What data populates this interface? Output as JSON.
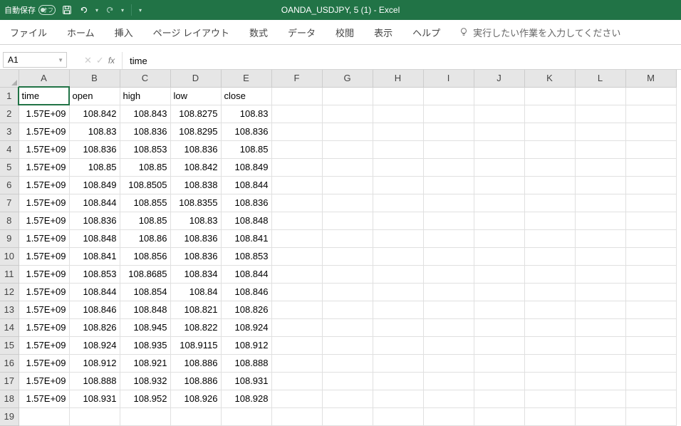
{
  "titlebar": {
    "autosave_label": "自動保存",
    "autosave_state": "オフ",
    "title": "OANDA_USDJPY, 5 (1)  -  Excel"
  },
  "ribbon": {
    "tabs": [
      "ファイル",
      "ホーム",
      "挿入",
      "ページ レイアウト",
      "数式",
      "データ",
      "校閲",
      "表示",
      "ヘルプ"
    ],
    "tellme_placeholder": "実行したい作業を入力してください"
  },
  "formula_bar": {
    "name_box": "A1",
    "formula": "time"
  },
  "grid": {
    "columns": [
      "A",
      "B",
      "C",
      "D",
      "E",
      "F",
      "G",
      "H",
      "I",
      "J",
      "K",
      "L",
      "M"
    ],
    "row_count": 19,
    "headers": [
      "time",
      "open",
      "high",
      "low",
      "close"
    ],
    "rows": [
      [
        "1.57E+09",
        "108.842",
        "108.843",
        "108.8275",
        "108.83"
      ],
      [
        "1.57E+09",
        "108.83",
        "108.836",
        "108.8295",
        "108.836"
      ],
      [
        "1.57E+09",
        "108.836",
        "108.853",
        "108.836",
        "108.85"
      ],
      [
        "1.57E+09",
        "108.85",
        "108.85",
        "108.842",
        "108.849"
      ],
      [
        "1.57E+09",
        "108.849",
        "108.8505",
        "108.838",
        "108.844"
      ],
      [
        "1.57E+09",
        "108.844",
        "108.855",
        "108.8355",
        "108.836"
      ],
      [
        "1.57E+09",
        "108.836",
        "108.85",
        "108.83",
        "108.848"
      ],
      [
        "1.57E+09",
        "108.848",
        "108.86",
        "108.836",
        "108.841"
      ],
      [
        "1.57E+09",
        "108.841",
        "108.856",
        "108.836",
        "108.853"
      ],
      [
        "1.57E+09",
        "108.853",
        "108.8685",
        "108.834",
        "108.844"
      ],
      [
        "1.57E+09",
        "108.844",
        "108.854",
        "108.84",
        "108.846"
      ],
      [
        "1.57E+09",
        "108.846",
        "108.848",
        "108.821",
        "108.826"
      ],
      [
        "1.57E+09",
        "108.826",
        "108.945",
        "108.822",
        "108.924"
      ],
      [
        "1.57E+09",
        "108.924",
        "108.935",
        "108.9115",
        "108.912"
      ],
      [
        "1.57E+09",
        "108.912",
        "108.921",
        "108.886",
        "108.888"
      ],
      [
        "1.57E+09",
        "108.888",
        "108.932",
        "108.886",
        "108.931"
      ],
      [
        "1.57E+09",
        "108.931",
        "108.952",
        "108.926",
        "108.928"
      ]
    ]
  }
}
